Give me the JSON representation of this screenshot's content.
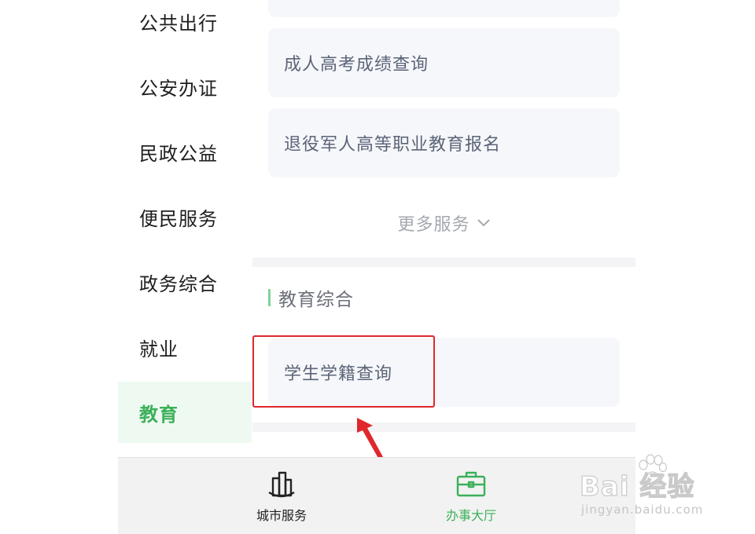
{
  "sidebar": {
    "items": [
      {
        "label": "公共出行",
        "active": false
      },
      {
        "label": "公安办证",
        "active": false
      },
      {
        "label": "民政公益",
        "active": false
      },
      {
        "label": "便民服务",
        "active": false
      },
      {
        "label": "政务综合",
        "active": false
      },
      {
        "label": "就业",
        "active": false
      },
      {
        "label": "教育",
        "active": true
      }
    ]
  },
  "content": {
    "cards": [
      {
        "label": "成人高考成绩查询"
      },
      {
        "label": "退役军人高等职业教育报名"
      }
    ],
    "more_label": "更多服务",
    "section": {
      "title": "教育综合",
      "cards": [
        {
          "label": "学生学籍查询"
        }
      ]
    }
  },
  "tabbar": {
    "tabs": [
      {
        "label": "城市服务",
        "icon": "city-buildings-icon",
        "active": false
      },
      {
        "label": "办事大厅",
        "icon": "briefcase-icon",
        "active": true
      }
    ]
  },
  "watermark": {
    "brand": "Bai  经验",
    "url": "jingyan.baidu.com"
  },
  "colors": {
    "accent": "#3cb05a",
    "highlight": "#e0272c",
    "card_bg": "#f6f7fb"
  }
}
